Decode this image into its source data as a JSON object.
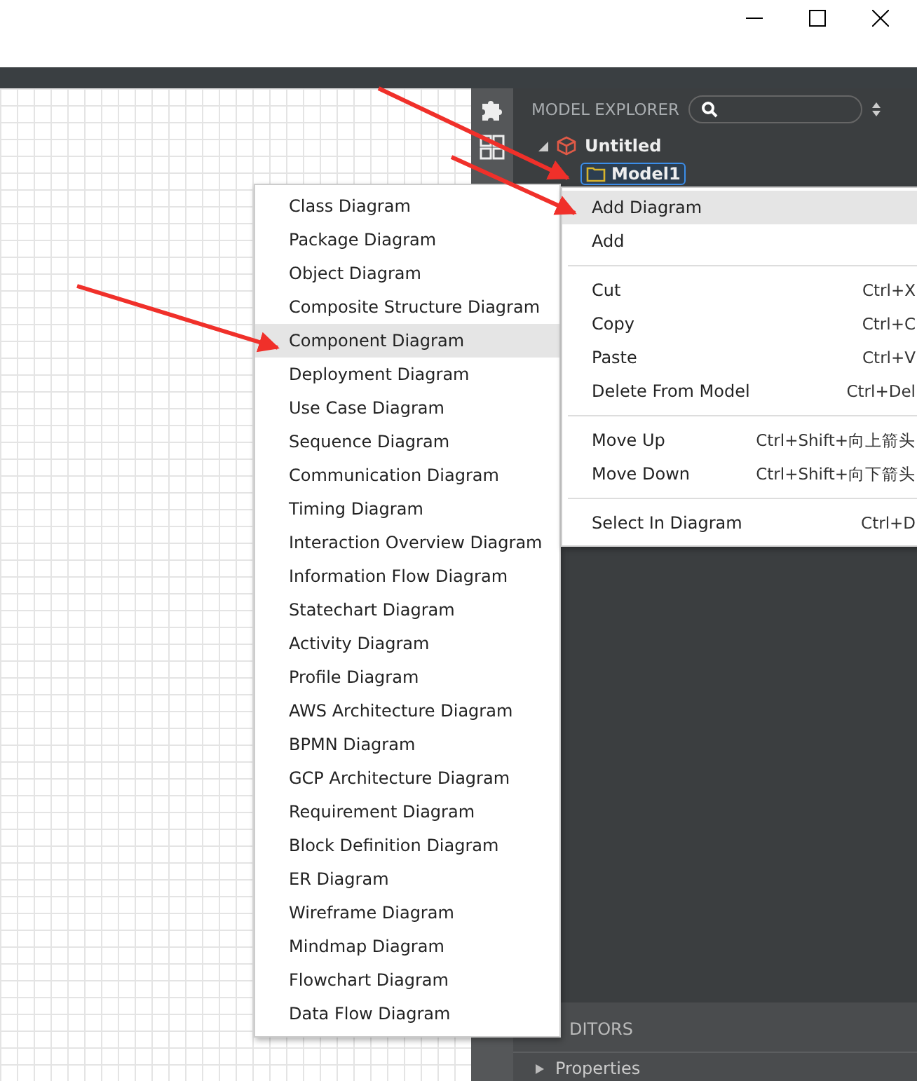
{
  "window": {
    "controls": [
      {
        "kind": "minimize"
      },
      {
        "kind": "maximize"
      },
      {
        "kind": "close"
      }
    ]
  },
  "sidebar_icons": [
    {
      "kind": "puzzle"
    },
    {
      "kind": "grid"
    }
  ],
  "model_explorer": {
    "title": "MODEL EXPLORER",
    "tree": [
      {
        "label": "Untitled",
        "kind": "project",
        "expanded": true,
        "children": [
          {
            "label": "Model1",
            "kind": "model",
            "selected": true
          }
        ]
      }
    ]
  },
  "editors": {
    "title": "DITORS",
    "items": [
      {
        "label": "Properties",
        "expanded": false
      }
    ]
  },
  "submenu": {
    "items": [
      {
        "label": "Class Diagram",
        "selected": false
      },
      {
        "label": "Package Diagram",
        "selected": false
      },
      {
        "label": "Object Diagram",
        "selected": false
      },
      {
        "label": "Composite Structure Diagram",
        "selected": false
      },
      {
        "label": "Component Diagram",
        "selected": true
      },
      {
        "label": "Deployment Diagram",
        "selected": false
      },
      {
        "label": "Use Case Diagram",
        "selected": false
      },
      {
        "label": "Sequence Diagram",
        "selected": false
      },
      {
        "label": "Communication Diagram",
        "selected": false
      },
      {
        "label": "Timing Diagram",
        "selected": false
      },
      {
        "label": "Interaction Overview Diagram",
        "selected": false
      },
      {
        "label": "Information Flow Diagram",
        "selected": false
      },
      {
        "label": "Statechart Diagram",
        "selected": false
      },
      {
        "label": "Activity Diagram",
        "selected": false
      },
      {
        "label": "Profile Diagram",
        "selected": false
      },
      {
        "label": "AWS Architecture Diagram",
        "selected": false
      },
      {
        "label": "BPMN Diagram",
        "selected": false
      },
      {
        "label": "GCP Architecture Diagram",
        "selected": false
      },
      {
        "label": "Requirement Diagram",
        "selected": false
      },
      {
        "label": "Block Definition Diagram",
        "selected": false
      },
      {
        "label": "ER Diagram",
        "selected": false
      },
      {
        "label": "Wireframe Diagram",
        "selected": false
      },
      {
        "label": "Mindmap Diagram",
        "selected": false
      },
      {
        "label": "Flowchart Diagram",
        "selected": false
      },
      {
        "label": "Data Flow Diagram",
        "selected": false
      }
    ]
  },
  "context_menu": {
    "groups": [
      [
        {
          "label": "Add Diagram",
          "selected": true
        },
        {
          "label": "Add",
          "selected": false
        }
      ],
      [
        {
          "label": "Cut",
          "shortcut": "Ctrl+X",
          "selected": false
        },
        {
          "label": "Copy",
          "shortcut": "Ctrl+C",
          "selected": false
        },
        {
          "label": "Paste",
          "shortcut": "Ctrl+V",
          "selected": false
        },
        {
          "label": "Delete From Model",
          "shortcut": "Ctrl+Del",
          "selected": false
        }
      ],
      [
        {
          "label": "Move Up",
          "shortcut": "Ctrl+Shift+向上箭头",
          "selected": false
        },
        {
          "label": "Move Down",
          "shortcut": "Ctrl+Shift+向下箭头",
          "selected": false
        }
      ],
      [
        {
          "label": "Select In Diagram",
          "shortcut": "Ctrl+D",
          "selected": false
        }
      ]
    ]
  }
}
